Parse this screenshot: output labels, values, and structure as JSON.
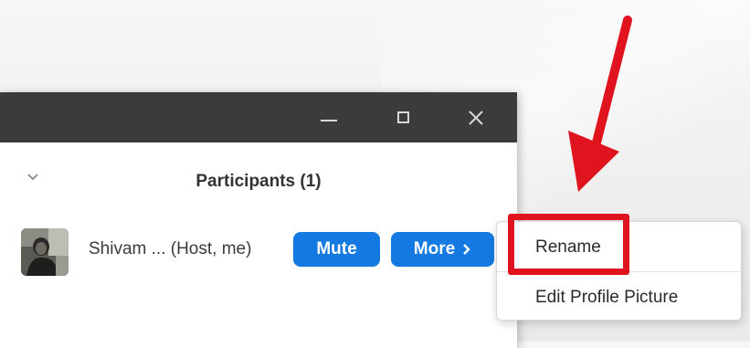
{
  "window": {
    "minimize_glyph": "—",
    "close_glyph": "✕"
  },
  "panel": {
    "title": "Participants (1)",
    "collapse_icon": "chevron-down-icon"
  },
  "participant": {
    "name": "Shivam ... (Host, me)",
    "mute_label": "Mute",
    "more_label": "More",
    "more_chevron": "›"
  },
  "context_menu": {
    "items": [
      {
        "label": "Rename"
      },
      {
        "label": "Edit Profile Picture"
      }
    ]
  },
  "colors": {
    "titlebar": "#3b3b3c",
    "button_blue": "#1479e0",
    "annotation_red": "#e0141e"
  }
}
